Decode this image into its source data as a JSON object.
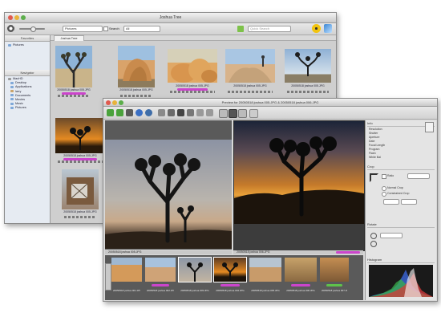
{
  "browser": {
    "title": "Joshua Tree",
    "path_select": "Pictures",
    "search_placeholder": "Quick Search",
    "filter_select": "All",
    "filter_label": "Search",
    "sidebar": {
      "favorites_header": "Favorites",
      "favorites": [
        "Pictures"
      ],
      "navigator_header": "Navigator",
      "tree": [
        "MacHD",
        "Desktop",
        "Applications",
        "larry",
        "Documents",
        "Movies",
        "Music",
        "Pictures"
      ]
    },
    "tab_label": "Joshua Tree",
    "thumbnails": [
      {
        "caption": "20050518 joshua 005.JPG",
        "label_color": "#cc44cc"
      },
      {
        "caption": "20050518 joshua 005.JPG",
        "label_color": ""
      },
      {
        "caption": "20050518 joshua 005.JPG",
        "label_color": "#cc44cc"
      },
      {
        "caption": "20050518 joshua 005.JPG",
        "label_color": ""
      },
      {
        "caption": "20050518 joshua 005.JPG",
        "label_color": ""
      },
      {
        "caption": "20050518 joshua 005.JPG",
        "label_color": "#cc44cc"
      },
      {
        "caption": "20050518 joshua 005.JPG",
        "label_color": ""
      }
    ]
  },
  "viewer": {
    "title": "Preview for 20050518 joshua 005.JPG & 20050518 joshua 006.JPG",
    "left_caption": "20050518 joshua 005.JPG",
    "right_caption": "20050518 joshua 006.JPG",
    "inspector": {
      "info_header": "Info",
      "info_rows": [
        "Resolution",
        "Shutter",
        "Aperture",
        "Date",
        "Focal Length",
        "Program",
        "Flash",
        "White Bal"
      ],
      "crop_header": "Crop",
      "crop_options": [
        "Ratio",
        "Normal Crop",
        "Constrained Crop"
      ],
      "rotate_header": "Rotate",
      "histogram_header": "Histogram"
    },
    "filmstrip": {
      "captions": [
        "20050518 joshua 001.JPG",
        "20050518 joshua 002.JPG",
        "20050518 joshua 003.JPG",
        "20050518 joshua 004.JPG",
        "20050518 joshua 005.JPG",
        "20050518 joshua 006.JPG",
        "20050518 joshua 007.JPG"
      ]
    }
  },
  "colors": {
    "label_purple": "#cc44cc",
    "selection_blue": "#3b6fd6",
    "dark_panel": "#5a5a5a"
  },
  "icons": [
    "gear-icon",
    "zoom-slider-icon",
    "search-icon",
    "burn-icon",
    "upload-icon",
    "rotate-icon",
    "compare-icon",
    "trash-icon"
  ]
}
